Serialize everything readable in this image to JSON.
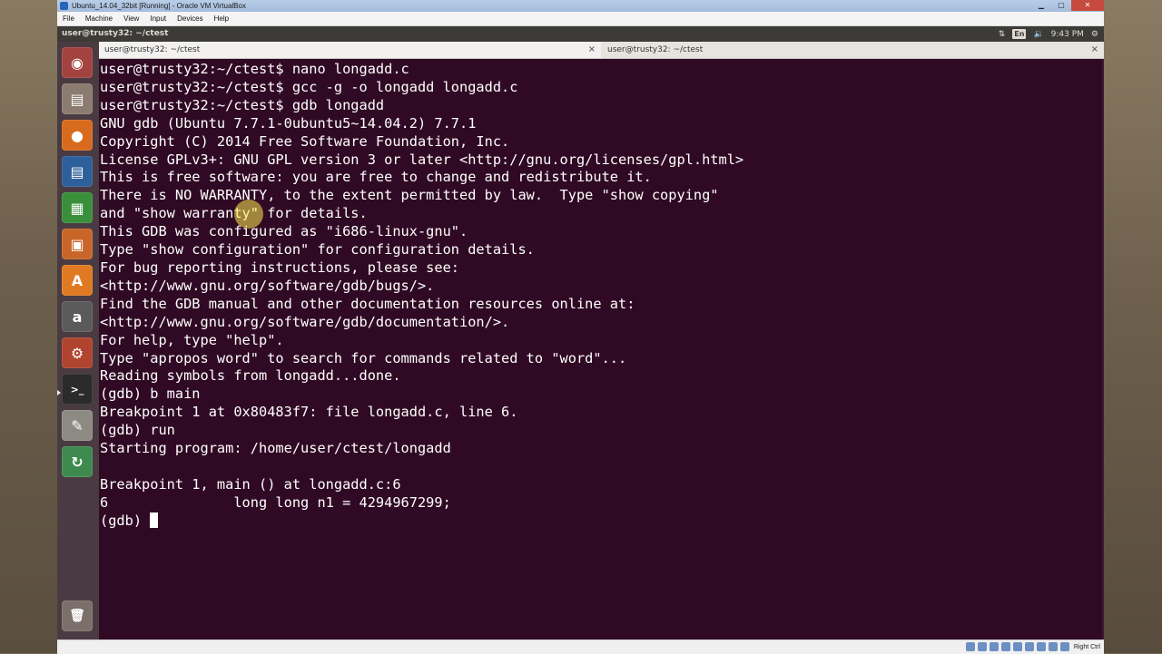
{
  "vbox": {
    "window_title": "Ubuntu_14.04_32bit [Running] - Oracle VM VirtualBox",
    "menu": [
      "File",
      "Machine",
      "View",
      "Input",
      "Devices",
      "Help"
    ],
    "host_key": "Right Ctrl"
  },
  "ubuntu_panel": {
    "title": "user@trusty32: ~/ctest",
    "keyboard_layout": "En",
    "clock": "9:43 PM"
  },
  "launcher": [
    {
      "name": "dash-home",
      "glyph": "◉"
    },
    {
      "name": "files",
      "glyph": "▤"
    },
    {
      "name": "firefox",
      "glyph": "●"
    },
    {
      "name": "libreoffice-writer",
      "glyph": "▤"
    },
    {
      "name": "libreoffice-calc",
      "glyph": "▦"
    },
    {
      "name": "libreoffice-impress",
      "glyph": "▣"
    },
    {
      "name": "ubuntu-software-center",
      "glyph": "A"
    },
    {
      "name": "amazon",
      "glyph": "a"
    },
    {
      "name": "system-settings",
      "glyph": "⚙"
    },
    {
      "name": "terminal",
      "glyph": ">_"
    },
    {
      "name": "text-editor",
      "glyph": "✎"
    },
    {
      "name": "software-updater",
      "glyph": "↻"
    },
    {
      "name": "trash",
      "glyph": "🗑"
    }
  ],
  "tabs": [
    {
      "label": "user@trusty32: ~/ctest",
      "close": "×"
    },
    {
      "label": "user@trusty32: ~/ctest",
      "close": "×"
    }
  ],
  "terminal_lines": [
    "user@trusty32:~/ctest$ nano longadd.c",
    "user@trusty32:~/ctest$ gcc -g -o longadd longadd.c",
    "user@trusty32:~/ctest$ gdb longadd",
    "GNU gdb (Ubuntu 7.7.1-0ubuntu5~14.04.2) 7.7.1",
    "Copyright (C) 2014 Free Software Foundation, Inc.",
    "License GPLv3+: GNU GPL version 3 or later <http://gnu.org/licenses/gpl.html>",
    "This is free software: you are free to change and redistribute it.",
    "There is NO WARRANTY, to the extent permitted by law.  Type \"show copying\"",
    "and \"show warranty\" for details.",
    "This GDB was configured as \"i686-linux-gnu\".",
    "Type \"show configuration\" for configuration details.",
    "For bug reporting instructions, please see:",
    "<http://www.gnu.org/software/gdb/bugs/>.",
    "Find the GDB manual and other documentation resources online at:",
    "<http://www.gnu.org/software/gdb/documentation/>.",
    "For help, type \"help\".",
    "Type \"apropos word\" to search for commands related to \"word\"...",
    "Reading symbols from longadd...done.",
    "(gdb) b main",
    "Breakpoint 1 at 0x80483f7: file longadd.c, line 6.",
    "(gdb) run",
    "Starting program: /home/user/ctest/longadd",
    "",
    "Breakpoint 1, main () at longadd.c:6",
    "6               long long n1 = 4294967299;"
  ],
  "prompt": "(gdb) "
}
